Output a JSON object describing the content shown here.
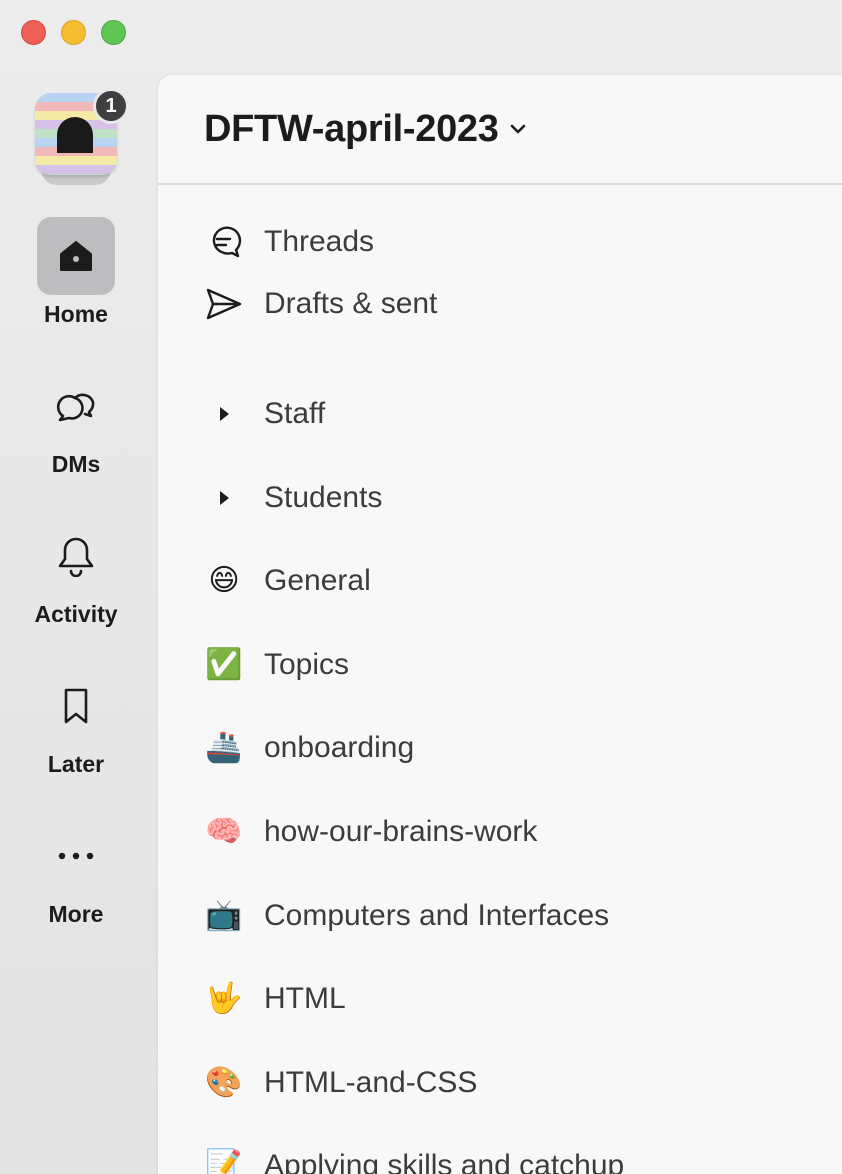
{
  "window": {
    "controls": [
      "close",
      "minimize",
      "zoom"
    ]
  },
  "workspace": {
    "badge_count": "1",
    "name": "DFTW-april-2023"
  },
  "rail": {
    "items": [
      {
        "label": "Home",
        "icon": "home-icon",
        "active": true
      },
      {
        "label": "DMs",
        "icon": "chat-bubbles-icon",
        "active": false
      },
      {
        "label": "Activity",
        "icon": "bell-icon",
        "active": false
      },
      {
        "label": "Later",
        "icon": "bookmark-icon",
        "active": false
      },
      {
        "label": "More",
        "icon": "ellipsis-icon",
        "active": false
      }
    ]
  },
  "sidebar": {
    "top_links": [
      {
        "label": "Threads",
        "icon": "threads-icon"
      },
      {
        "label": "Drafts & sent",
        "icon": "send-icon"
      }
    ],
    "sections": [
      {
        "label": "Staff",
        "icon": "caret-right-icon"
      },
      {
        "label": "Students",
        "icon": "caret-right-icon"
      }
    ],
    "channels": [
      {
        "emoji": "😄",
        "label": "General"
      },
      {
        "emoji": "✅",
        "label": "Topics"
      },
      {
        "emoji": "🚢",
        "label": "onboarding"
      },
      {
        "emoji": "🧠",
        "label": "how-our-brains-work"
      },
      {
        "emoji": "📺",
        "label": "Computers and Interfaces"
      },
      {
        "emoji": "🤟",
        "label": "HTML"
      },
      {
        "emoji": "🎨",
        "label": "HTML-and-CSS"
      },
      {
        "emoji": "📝",
        "label": "Applying skills and catchup"
      }
    ]
  }
}
